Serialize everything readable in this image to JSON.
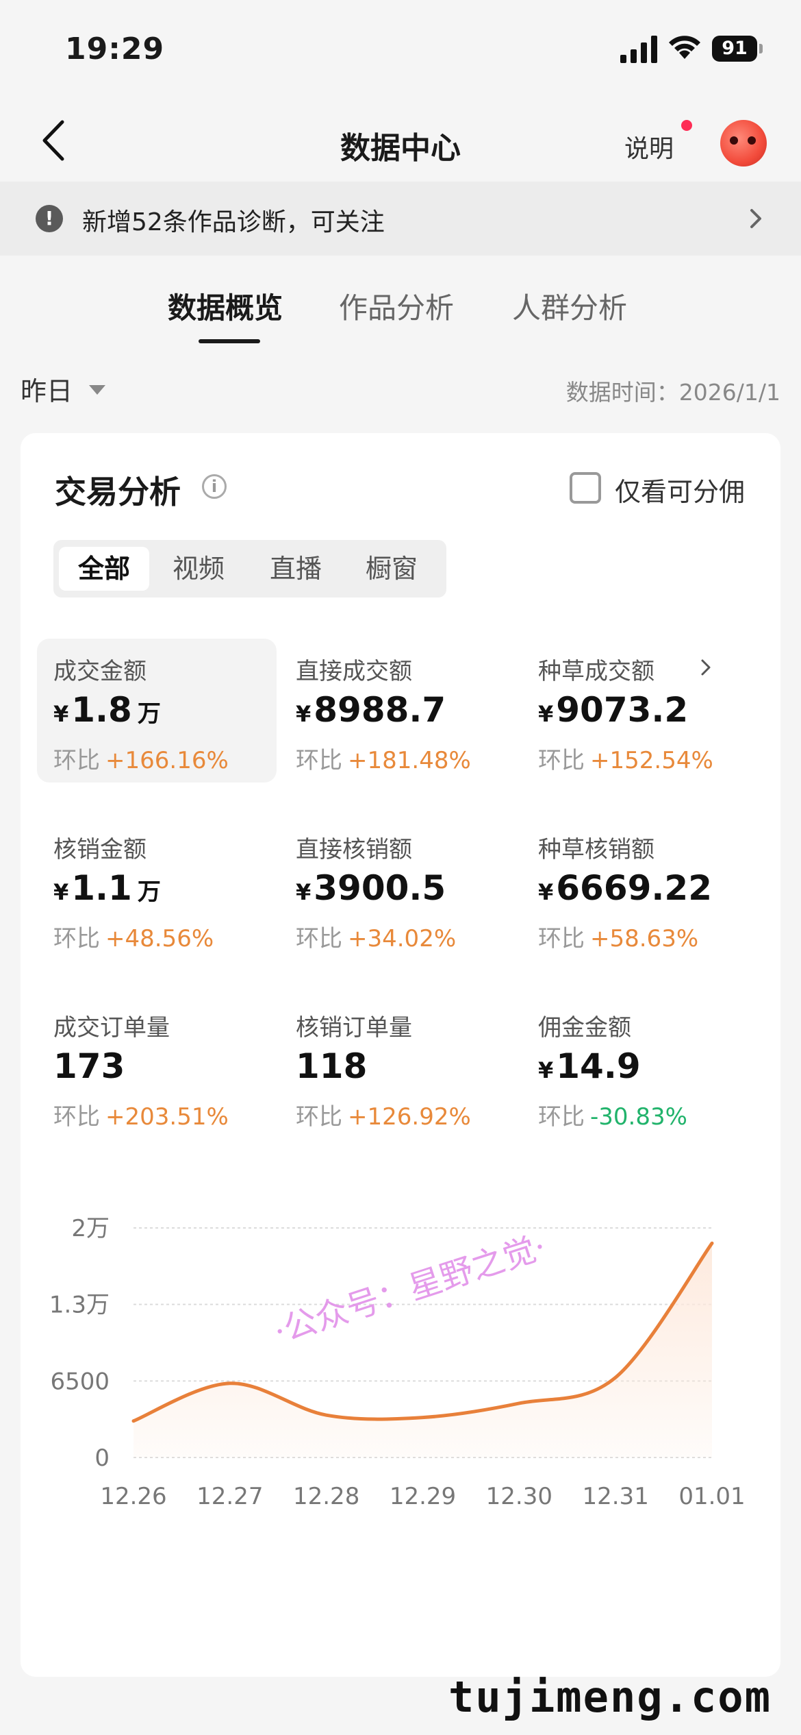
{
  "status_bar": {
    "time": "19:29",
    "battery": "91"
  },
  "nav": {
    "title": "数据中心",
    "help_label": "说明"
  },
  "notice": {
    "text": "新增52条作品诊断，可关注"
  },
  "tabs": [
    {
      "label": "数据概览",
      "active": true
    },
    {
      "label": "作品分析",
      "active": false
    },
    {
      "label": "人群分析",
      "active": false
    }
  ],
  "date_filter": {
    "selected": "昨日",
    "data_time": "数据时间：2026/1/1"
  },
  "card": {
    "title": "交易分析",
    "checkbox_label": "仅看可分佣",
    "segments": [
      {
        "label": "全部",
        "active": true
      },
      {
        "label": "视频",
        "active": false
      },
      {
        "label": "直播",
        "active": false
      },
      {
        "label": "橱窗",
        "active": false
      }
    ],
    "metrics": [
      {
        "label": "成交金额",
        "currency": "¥",
        "value": "1.8",
        "unit": "万",
        "change_label": "环比",
        "change": "+166.16%",
        "trend": "up",
        "highlight": true
      },
      {
        "label": "直接成交额",
        "currency": "¥",
        "value": "8988.7",
        "unit": "",
        "change_label": "环比",
        "change": "+181.48%",
        "trend": "up"
      },
      {
        "label": "种草成交额",
        "currency": "¥",
        "value": "9073.2",
        "unit": "",
        "change_label": "环比",
        "change": "+152.54%",
        "trend": "up",
        "has_chevron": true
      },
      {
        "label": "核销金额",
        "currency": "¥",
        "value": "1.1",
        "unit": "万",
        "change_label": "环比",
        "change": "+48.56%",
        "trend": "up"
      },
      {
        "label": "直接核销额",
        "currency": "¥",
        "value": "3900.5",
        "unit": "",
        "change_label": "环比",
        "change": "+34.02%",
        "trend": "up"
      },
      {
        "label": "种草核销额",
        "currency": "¥",
        "value": "6669.22",
        "unit": "",
        "change_label": "环比",
        "change": "+58.63%",
        "trend": "up"
      },
      {
        "label": "成交订单量",
        "currency": "",
        "value": "173",
        "unit": "",
        "change_label": "环比",
        "change": "+203.51%",
        "trend": "up"
      },
      {
        "label": "核销订单量",
        "currency": "",
        "value": "118",
        "unit": "",
        "change_label": "环比",
        "change": "+126.92%",
        "trend": "up"
      },
      {
        "label": "佣金金额",
        "currency": "¥",
        "value": "14.9",
        "unit": "",
        "change_label": "环比",
        "change": "-30.83%",
        "trend": "down"
      }
    ]
  },
  "chart_data": {
    "type": "area",
    "x": [
      "12.26",
      "12.27",
      "12.28",
      "12.29",
      "12.30",
      "12.31",
      "01.01"
    ],
    "series": [
      {
        "values": [
          3100,
          6300,
          3600,
          3400,
          4600,
          6800,
          18200
        ]
      }
    ],
    "yticks": [
      {
        "value": 0,
        "label": "0"
      },
      {
        "value": 6500,
        "label": "6500"
      },
      {
        "value": 13000,
        "label": "1.3万"
      },
      {
        "value": 19500,
        "label": "2万"
      }
    ],
    "ylim": [
      0,
      19500
    ],
    "line_color": "#e8803a",
    "fill_color": "#fde9dc",
    "grid": true
  },
  "watermark": "·公众号：星野之觉·",
  "brand": "tujimeng.com",
  "colors": {
    "up": "#e8893a",
    "down": "#21b36b",
    "accent": "#fe2c55"
  }
}
